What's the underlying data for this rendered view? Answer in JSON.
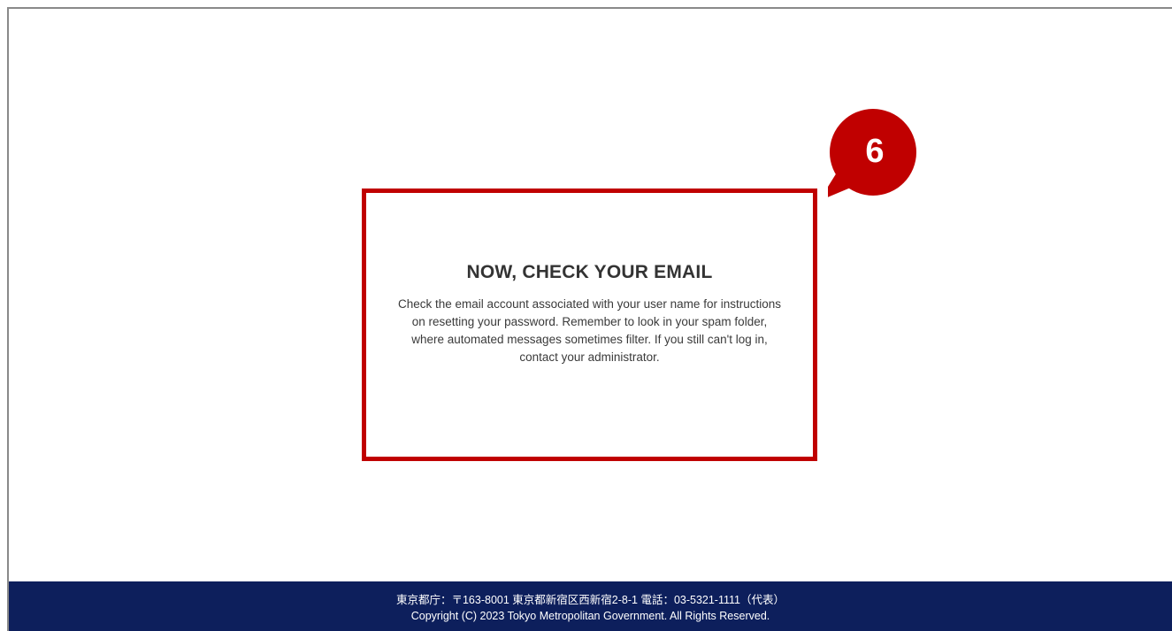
{
  "panel": {
    "title": "NOW, CHECK YOUR EMAIL",
    "message": "Check the email account associated with your user name for instructions on resetting your password. Remember to look in your spam folder, where automated messages sometimes filter. If you still can't log in, contact your administrator."
  },
  "callout": {
    "number": "6",
    "color": "#c00000"
  },
  "footer": {
    "address": "東京都庁：〒163-8001 東京都新宿区西新宿2-8-1 電話：03-5321-1111（代表）",
    "copyright": "Copyright (C) 2023 Tokyo Metropolitan Government. All Rights Reserved.",
    "background": "#0d1f5c"
  },
  "colors": {
    "highlight_border": "#c00000",
    "frame_border": "#8a8a8a"
  }
}
